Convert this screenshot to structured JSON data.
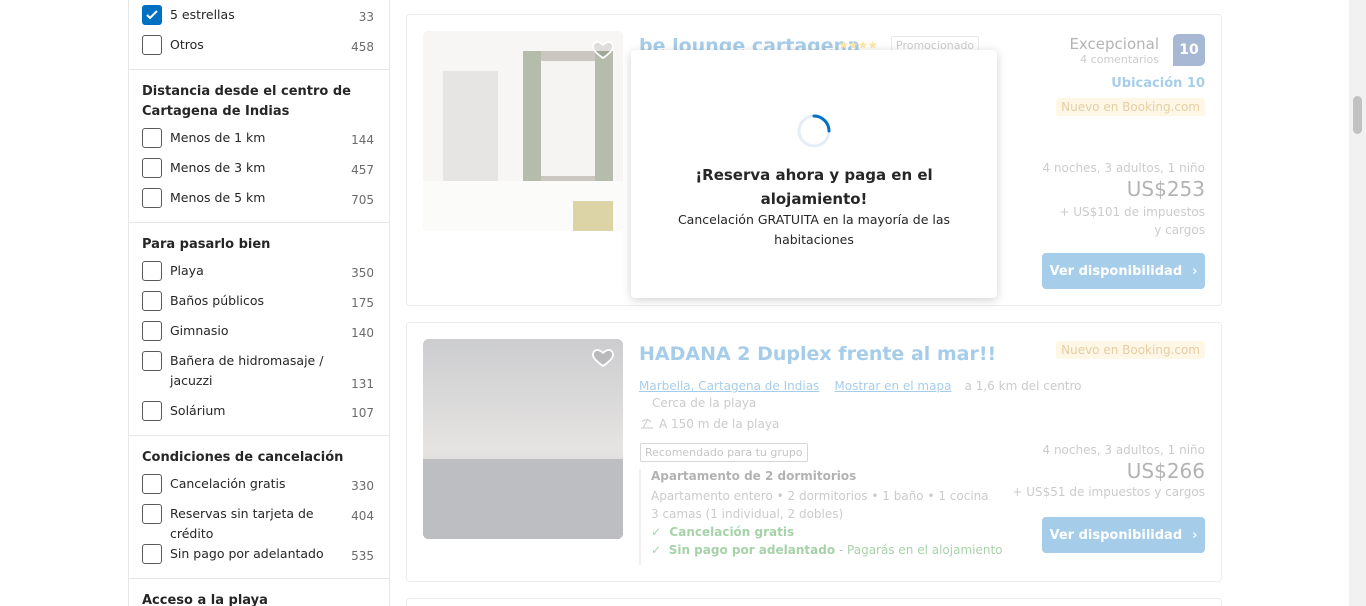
{
  "filters": {
    "stars": [
      {
        "label": "5 estrellas",
        "count": "33",
        "checked": true
      },
      {
        "label": "Otros",
        "count": "458",
        "checked": false
      }
    ],
    "distance": {
      "title": "Distancia desde el centro de Cartagena de Indias",
      "items": [
        {
          "label": "Menos de 1 km",
          "count": "144"
        },
        {
          "label": "Menos de 3 km",
          "count": "457"
        },
        {
          "label": "Menos de 5 km",
          "count": "705"
        }
      ]
    },
    "fun": {
      "title": "Para pasarlo bien",
      "items": [
        {
          "label": "Playa",
          "count": "350"
        },
        {
          "label": "Baños públicos",
          "count": "175"
        },
        {
          "label": "Gimnasio",
          "count": "140"
        },
        {
          "label": "Bañera de hidromasaje / jacuzzi",
          "count": "131"
        },
        {
          "label": "Solárium",
          "count": "107"
        }
      ]
    },
    "cancel": {
      "title": "Condiciones de cancelación",
      "items": [
        {
          "label": "Cancelación gratis",
          "count": "330"
        },
        {
          "label": "Reservas sin tarjeta de crédito",
          "count": "404"
        },
        {
          "label": "Sin pago por adelantado",
          "count": "535"
        }
      ]
    },
    "beach": {
      "title": "Acceso a la playa"
    }
  },
  "results": [
    {
      "name": "be lounge cartagena",
      "promoted": "Promocionado",
      "rating_word": "Excepcional",
      "reviews": "4 comentarios",
      "score": "10",
      "location_score": "Ubicación 10",
      "new_badge": "Nuevo en Booking.com",
      "stay": "4 noches, 3 adultos, 1 niño",
      "price": "US$253",
      "taxes": "+ US$101 de impuestos y cargos",
      "button": "Ver disponibilidad"
    },
    {
      "name": "HADANA 2 Duplex frente al mar!!",
      "new_badge": "Nuevo en Booking.com",
      "area": "Marbella, Cartagena de Indias",
      "map_link": "Mostrar en el mapa",
      "distance": "a 1,6 km del centro",
      "near_beach": "Cerca de la playa",
      "beach_dist": "A 150 m de la playa",
      "recommended": "Recomendado para tu grupo",
      "unit_name": "Apartamento de 2 dormitorios",
      "unit_desc": "Apartamento entero • 2 dormitorios • 1 baño • 1 cocina",
      "beds": "3 camas (1 individual, 2 dobles)",
      "free_cancel": "Cancelación gratis",
      "no_prepay": "Sin pago por adelantado",
      "pay_at": "- Pagarás en el alojamiento",
      "stay": "4 noches, 3 adultos, 1 niño",
      "price": "US$266",
      "taxes": "+ US$51 de impuestos y cargos",
      "button": "Ver disponibilidad"
    }
  ],
  "modal": {
    "title": "¡Reserva ahora y paga en el alojamiento!",
    "subtitle": "Cancelación GRATUITA en la mayoría de las habitaciones"
  },
  "colors": {
    "accent": "#0071c2",
    "star": "#febb02",
    "badge_bg": "#fde9b8"
  }
}
